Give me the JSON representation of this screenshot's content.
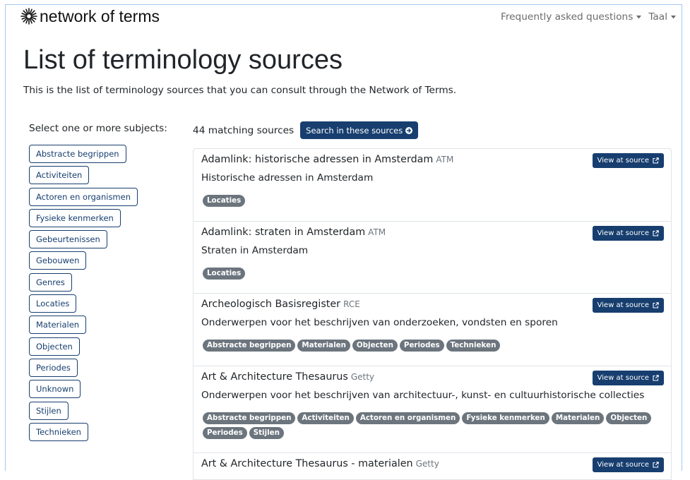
{
  "header": {
    "logo_text": "network of terms",
    "nav": [
      {
        "label": "Frequently asked questions"
      },
      {
        "label": "Taal"
      }
    ]
  },
  "page": {
    "title": "List of terminology sources",
    "intro": "This is the list of terminology sources that you can consult through the Network of Terms."
  },
  "filters": {
    "heading": "Select one or more subjects:",
    "subjects": [
      "Abstracte begrippen",
      "Activiteiten",
      "Actoren en organismen",
      "Fysieke kenmerken",
      "Gebeurtenissen",
      "Gebouwen",
      "Genres",
      "Locaties",
      "Materialen",
      "Objecten",
      "Periodes",
      "Unknown",
      "Stijlen",
      "Technieken"
    ]
  },
  "results": {
    "count_text": "44 matching sources",
    "search_button": "Search in these sources",
    "view_button": "View at source",
    "sources": [
      {
        "name": "Adamlink: historische adressen in Amsterdam",
        "org": "ATM",
        "description": "Historische adressen in Amsterdam",
        "subjects": [
          "Locaties"
        ]
      },
      {
        "name": "Adamlink: straten in Amsterdam",
        "org": "ATM",
        "description": "Straten in Amsterdam",
        "subjects": [
          "Locaties"
        ]
      },
      {
        "name": "Archeologisch Basisregister",
        "org": "RCE",
        "description": "Onderwerpen voor het beschrijven van onderzoeken, vondsten en sporen",
        "subjects": [
          "Abstracte begrippen",
          "Materialen",
          "Objecten",
          "Periodes",
          "Technieken"
        ]
      },
      {
        "name": "Art & Architecture Thesaurus",
        "org": "Getty",
        "description": "Onderwerpen voor het beschrijven van architectuur-, kunst- en cultuurhistorische collecties",
        "subjects": [
          "Abstracte begrippen",
          "Activiteiten",
          "Actoren en organismen",
          "Fysieke kenmerken",
          "Materialen",
          "Objecten",
          "Periodes",
          "Stijlen"
        ]
      },
      {
        "name": "Art & Architecture Thesaurus - materialen",
        "org": "Getty"
      }
    ]
  },
  "colors": {
    "primary": "#173e6f",
    "badge": "#6c757d",
    "text": "#212529",
    "muted": "#6c757d",
    "nav_text": "#6b6b6b",
    "border": "#dfe3e8",
    "frame": "#a6c8f0"
  },
  "icons": {
    "logo": "sunburst-logo-icon",
    "dropdown": "caret-down-icon",
    "search_button": "circle-arrow-right-icon",
    "view_button": "external-link-icon"
  }
}
